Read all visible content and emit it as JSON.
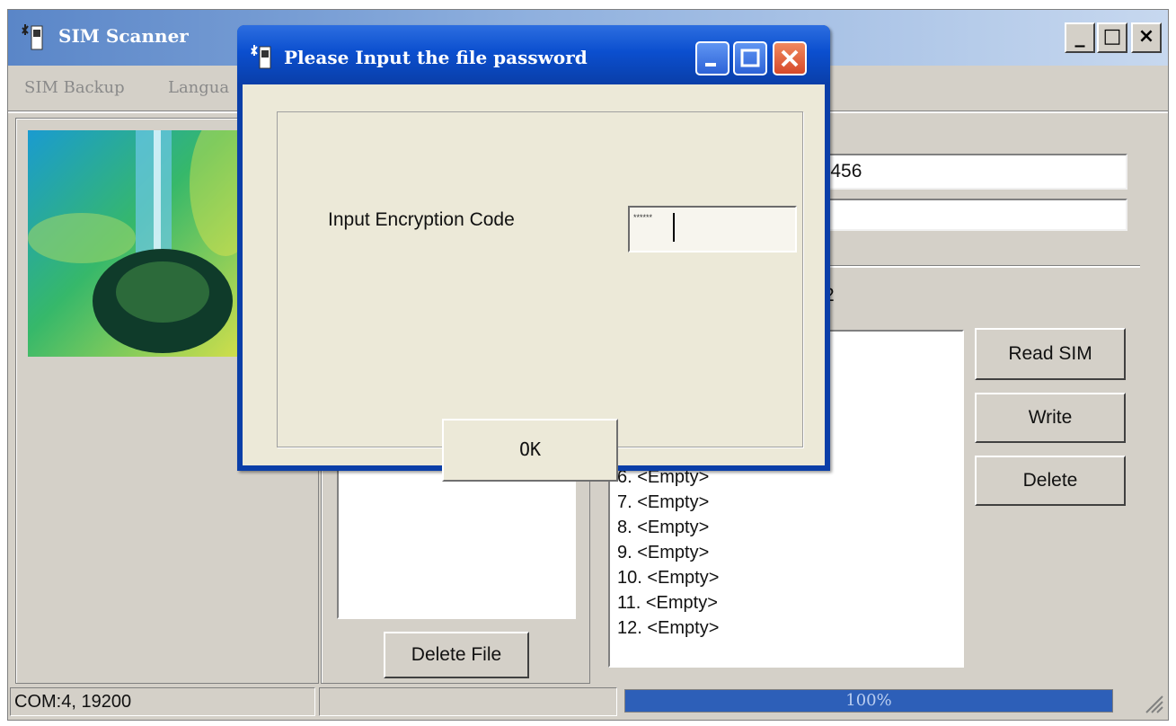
{
  "app": {
    "title": "SIM Scanner"
  },
  "window_controls": {
    "minimize": "_",
    "maximize": "□",
    "close": "×"
  },
  "menu": [
    {
      "label": "SIM Backup"
    },
    {
      "label": "Langua"
    }
  ],
  "main": {
    "card_number_fragment": "23456",
    "second_field": "",
    "phonebook_count_fragment": "2",
    "delete_file_label": "Delete File",
    "buttons": {
      "read": "Read SIM",
      "write": "Write",
      "delete": "Delete"
    },
    "sim_entries": [
      "6. <Empty>",
      "7. <Empty>",
      "8. <Empty>",
      "9. <Empty>",
      "10. <Empty>",
      "11. <Empty>",
      "12. <Empty>"
    ]
  },
  "status": {
    "port": "COM:4, 19200",
    "progress": 100,
    "progress_label": "100%"
  },
  "dialog": {
    "title": "Please Input the file password",
    "label": "Input Encryption Code",
    "input_value": "******",
    "ok_label": "OK"
  }
}
